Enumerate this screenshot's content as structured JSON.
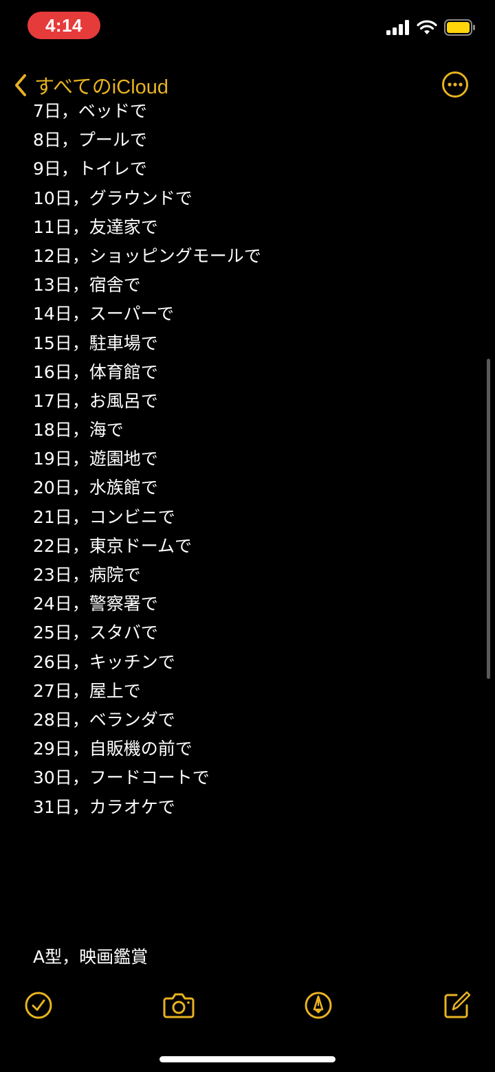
{
  "status": {
    "time": "4:14"
  },
  "nav": {
    "back_label": "すべてのiCloud"
  },
  "note": {
    "lines": [
      "7日，ベッドで",
      "8日，プールで",
      "9日，トイレで",
      "10日，グラウンドで",
      "11日，友達家で",
      "12日，ショッピングモールで",
      "13日，宿舎で",
      "14日，スーパーで",
      "15日，駐車場で",
      "16日，体育館で",
      "17日，お風呂で",
      "18日，海で",
      "19日，遊園地で",
      "20日，水族館で",
      "21日，コンビニで",
      "22日，東京ドームで",
      "23日，病院で",
      "24日，警察署で",
      "25日，スタバで",
      "26日，キッチンで",
      "27日，屋上で",
      "28日，ベランダで",
      "29日，自販機の前で",
      "30日，フードコートで",
      "31日，カラオケで"
    ],
    "footer_line": "A型，映画鑑賞"
  },
  "colors": {
    "accent": "#e9b321",
    "background": "#000000",
    "time_pill": "#e63b3b",
    "text": "#ffffff"
  },
  "icons": {
    "back": "chevron-left-icon",
    "more": "ellipsis-circle-icon",
    "checklist": "checkmark-circle-icon",
    "camera": "camera-icon",
    "markup": "pen-tip-circle-icon",
    "compose": "compose-icon"
  }
}
